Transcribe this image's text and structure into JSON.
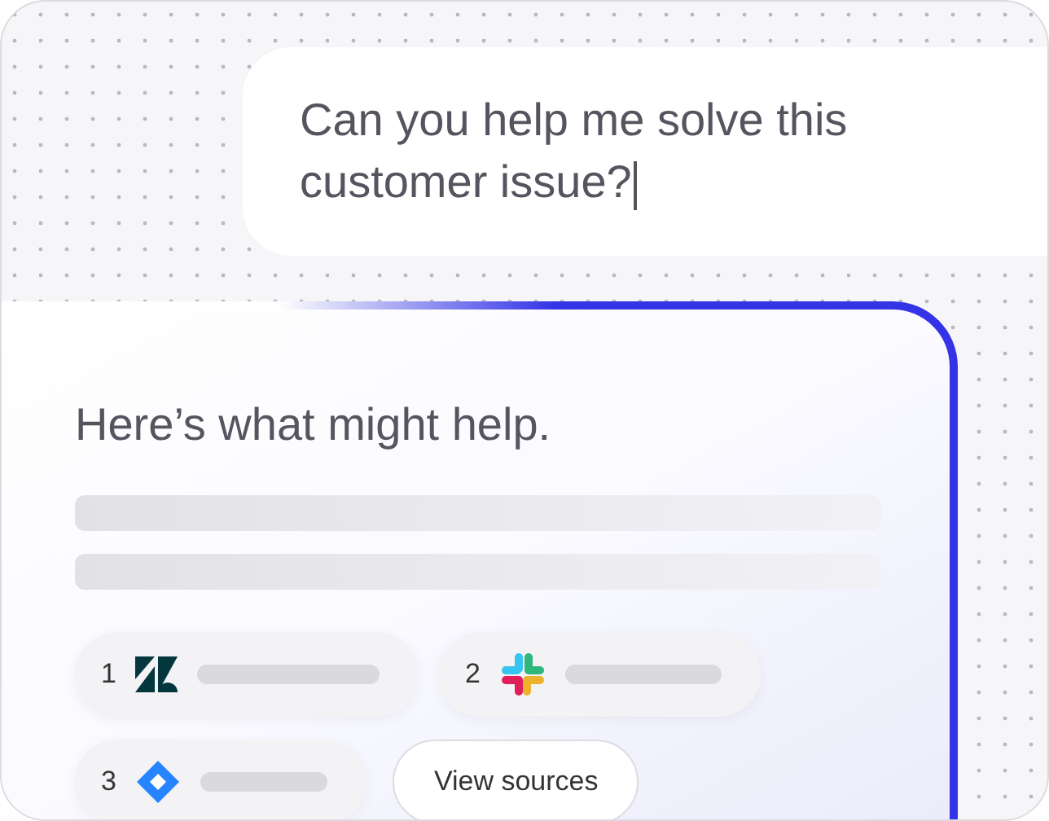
{
  "prompt": {
    "text": "Can you help me solve this customer issue?"
  },
  "answer": {
    "heading": "Here’s what might help.",
    "sources": [
      {
        "number": "1",
        "kind": "z-mark"
      },
      {
        "number": "2",
        "kind": "hash-mark"
      },
      {
        "number": "3",
        "kind": "diamond-mark"
      }
    ],
    "button": "View sources"
  }
}
